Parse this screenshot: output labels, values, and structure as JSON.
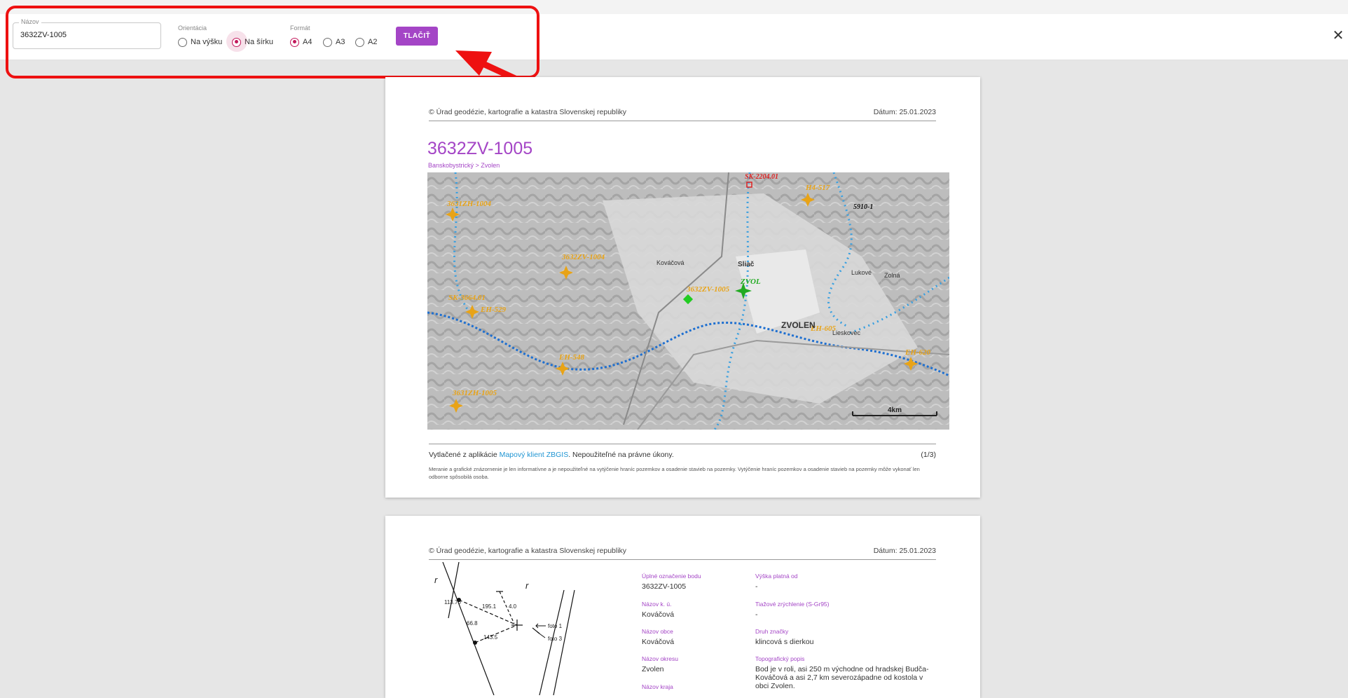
{
  "toolbar": {
    "name_label": "Názov",
    "name_value": "3632ZV-1005",
    "orientation_label": "Orientácia",
    "orientation_options": [
      "Na výšku",
      "Na šírku"
    ],
    "orientation_selected": "Na šírku",
    "format_label": "Formát",
    "format_options": [
      "A4",
      "A3",
      "A2"
    ],
    "format_selected": "A4",
    "print_label": "TLAČIŤ",
    "close_glyph": "✕"
  },
  "page1": {
    "copyright": "© Úrad geodézie, kartografie a katastra Slovenskej republiky",
    "date": "Dátum: 25.01.2023",
    "title": "3632ZV-1005",
    "breadcrumb": "Banskobystrický > Zvolen",
    "map": {
      "labels": [
        "3631ZH-1004",
        "3632ZV-1004",
        "SK-3664.01",
        "EH-529",
        "EH-548",
        "3631ZH-1005",
        "3632ZV-1005",
        "ZVOL",
        "ZVOLEN",
        "EH-605",
        "EH-620",
        "SK-2204.01",
        "H4-517",
        "5910-1",
        "Sliač",
        "Lieskovec",
        "Zolná",
        "Lukové",
        "Kováčová"
      ],
      "scale_label": "4km"
    },
    "footer_prefix": "Vytlačené z aplikácie ",
    "footer_link": "Mapový klient ZBGIS",
    "footer_suffix": ". Nepoužiteľné na právne úkony.",
    "page_number": "(1/3)",
    "disclaimer": "Meranie a grafické znázornenie je len informatívne a je nepoužiteľné na vytýčenie hraníc pozemkov a osadenie stavieb na pozemky. Vytýčenie hraníc pozemkov a osadenie stavieb na pozemky môže vykonať len odborne spôsobilá osoba."
  },
  "page2": {
    "copyright": "© Úrad geodézie, kartografie a katastra Slovenskej republiky",
    "date": "Dátum: 25.01.2023",
    "sketch_labels": [
      "r",
      "r",
      "113.70",
      "66.8",
      "195.1",
      "143.5",
      "4.0",
      "foto 1",
      "foto 3"
    ],
    "left_fields": [
      {
        "key": "Úplné označenie bodu",
        "value": "3632ZV-1005"
      },
      {
        "key": "Názov k. ú.",
        "value": "Kováčová"
      },
      {
        "key": "Názov obce",
        "value": "Kováčová"
      },
      {
        "key": "Názov okresu",
        "value": "Zvolen"
      },
      {
        "key": "Názov kraja",
        "value": ""
      }
    ],
    "right_fields": [
      {
        "key": "Výška platná od",
        "value": "-"
      },
      {
        "key": "Tiažové zrýchlenie (S-Gr95)",
        "value": "-"
      },
      {
        "key": "Druh značky",
        "value": "klincová s dierkou"
      },
      {
        "key": "Topografický popis",
        "value": "Bod je v roli, asi 250 m východne od hradskej Budča-Kováčová a asi 2,7 km severozápadne od kostola v obci Zvolen."
      }
    ]
  },
  "colors": {
    "accent": "#a445c6",
    "radio": "#c2185b",
    "highlight": "#ee1111",
    "link": "#2196d3"
  }
}
